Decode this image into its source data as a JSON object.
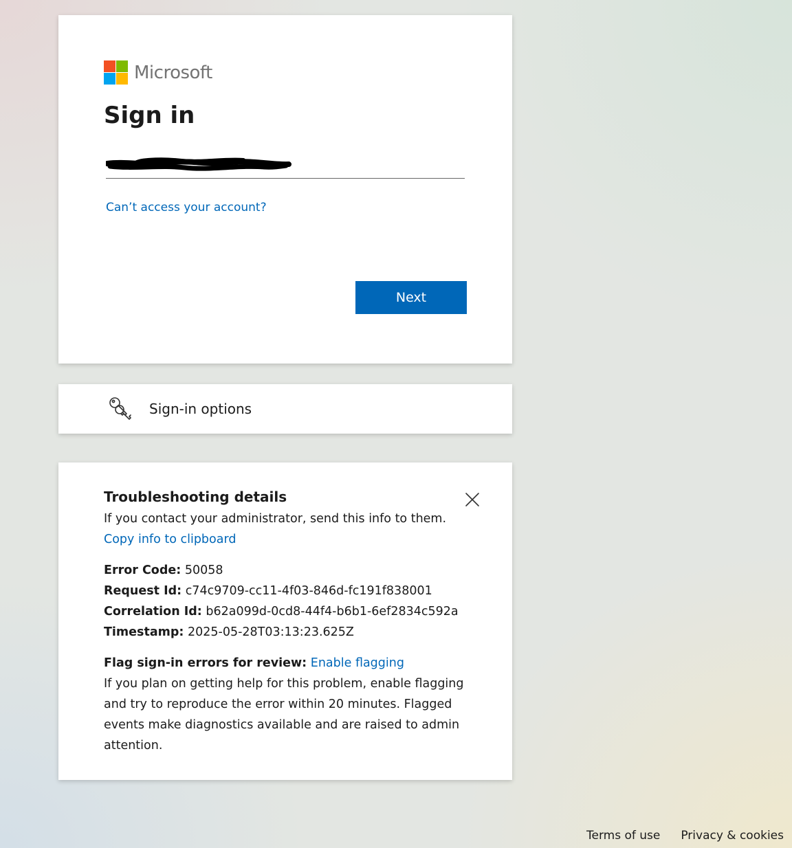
{
  "brand": {
    "name": "Microsoft",
    "logo_colors": [
      "#f25022",
      "#7fba00",
      "#00a4ef",
      "#ffb900"
    ]
  },
  "signin": {
    "title": "Sign in",
    "cant_access_link": "Can’t access your account?",
    "next_label": "Next"
  },
  "options": {
    "label": "Sign-in options",
    "icon": "key-icon"
  },
  "troubleshooting": {
    "heading": "Troubleshooting details",
    "intro": "If you contact your administrator, send this info to them.",
    "copy_link": "Copy info to clipboard",
    "details": [
      {
        "label": "Error Code:",
        "value": "50058"
      },
      {
        "label": "Request Id:",
        "value": "c74c9709-cc11-4f03-846d-fc191f838001"
      },
      {
        "label": "Correlation Id:",
        "value": "b62a099d-0cd8-44f4-b6b1-6ef2834c592a"
      },
      {
        "label": "Timestamp:",
        "value": "2025-05-28T03:13:23.625Z"
      }
    ],
    "flag_label": "Flag sign-in errors for review:",
    "flag_link": "Enable flagging",
    "flag_description": "If you plan on getting help for this problem, enable flagging and try to reproduce the error within 20 minutes. Flagged events make diagnostics available and are raised to admin attention."
  },
  "footer": {
    "terms": "Terms of use",
    "privacy": "Privacy & cookies"
  },
  "colors": {
    "accent": "#0067b8",
    "link": "#0067b8",
    "text": "#1b1b1b"
  }
}
